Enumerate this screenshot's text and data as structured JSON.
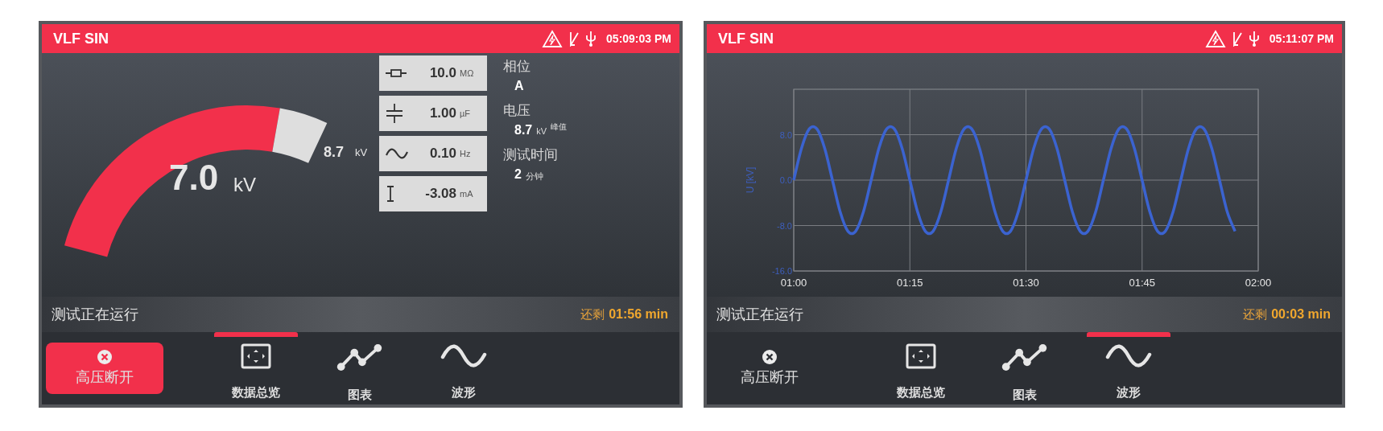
{
  "screens": [
    {
      "kind": "gauge",
      "header": {
        "title": "VLF SIN",
        "time": "05:09:03 PM"
      },
      "gauge": {
        "value": "7.0",
        "unit": "kV",
        "limit": "8.7",
        "limit_unit": "kV"
      },
      "readings": [
        {
          "kind": "resistance",
          "value": "10.0",
          "unit": "MΩ"
        },
        {
          "kind": "capacitance",
          "value": "1.00",
          "unit": "µF"
        },
        {
          "kind": "frequency",
          "value": "0.10",
          "unit": "Hz"
        },
        {
          "kind": "current",
          "value": "-3.08",
          "unit": "mA"
        }
      ],
      "info": [
        {
          "label": "相位",
          "value": "A"
        },
        {
          "label": "电压",
          "value": "8.7",
          "unit": "kV",
          "note": "峰值"
        },
        {
          "label": "测试时间",
          "value": "2",
          "unit": "分钟"
        }
      ],
      "status": {
        "text": "测试正在运行",
        "remaining_label": "还剩",
        "remaining": "01:56 min"
      },
      "stop_button": {
        "label": "高压断开",
        "active": true
      },
      "tabs": [
        {
          "kind": "overview",
          "label": "数据总览",
          "selected": true
        },
        {
          "kind": "chart",
          "label": "图表",
          "selected": false
        },
        {
          "kind": "wave",
          "label": "波形",
          "selected": false
        }
      ]
    },
    {
      "kind": "chart",
      "header": {
        "title": "VLF SIN",
        "time": "05:11:07 PM"
      },
      "chart_data": {
        "type": "line",
        "ylabel": "U [kV]",
        "x": [
          60,
          61,
          62,
          63,
          64,
          65,
          66,
          67,
          68,
          69,
          70,
          71,
          72,
          73,
          74,
          75,
          76,
          77,
          78,
          79,
          80,
          81,
          82,
          83,
          84,
          85,
          86,
          87,
          88,
          89,
          90,
          91,
          92,
          93,
          94,
          95,
          96,
          97,
          98,
          99,
          100,
          101,
          102,
          103,
          104,
          105,
          106,
          107,
          108,
          109,
          110,
          111,
          112,
          113,
          114,
          115,
          116,
          117
        ],
        "series": [
          {
            "color": "#3b63d0",
            "values": [
              0,
              5.6,
              9.0,
              9.0,
              5.6,
              0,
              -5.6,
              -9.0,
              -9.0,
              -5.6,
              0,
              5.6,
              9.0,
              9.0,
              5.6,
              0,
              -5.6,
              -9.0,
              -9.0,
              -5.6,
              0,
              5.6,
              9.0,
              9.0,
              5.6,
              0,
              -5.6,
              -9.0,
              -9.0,
              -5.6,
              0,
              5.6,
              9.0,
              9.0,
              5.6,
              0,
              -5.6,
              -9.0,
              -9.0,
              -5.6,
              0,
              5.6,
              9.0,
              9.0,
              5.6,
              0,
              -5.6,
              -9.0,
              -9.0,
              -5.6,
              0,
              5.6,
              9.0,
              9.0,
              5.6,
              0,
              -5.6,
              -9.0
            ]
          }
        ],
        "xlim": [
          60,
          120
        ],
        "ylim": [
          -16,
          16
        ],
        "grid": true,
        "xticks": [
          {
            "value": 60,
            "label": "01:00"
          },
          {
            "value": 75,
            "label": "01:15"
          },
          {
            "value": 90,
            "label": "01:30"
          },
          {
            "value": 105,
            "label": "01:45"
          },
          {
            "value": 120,
            "label": "02:00"
          }
        ],
        "yticks": [
          {
            "value": 8,
            "label": "8.0"
          },
          {
            "value": 0,
            "label": "0.0"
          },
          {
            "value": -8,
            "label": "-8.0"
          },
          {
            "value": -16,
            "label": "-16.0"
          }
        ]
      },
      "status": {
        "text": "测试正在运行",
        "remaining_label": "还剩",
        "remaining": "00:03 min"
      },
      "stop_button": {
        "label": "高压断开",
        "active": false
      },
      "tabs": [
        {
          "kind": "overview",
          "label": "数据总览",
          "selected": false
        },
        {
          "kind": "chart",
          "label": "图表",
          "selected": false
        },
        {
          "kind": "wave",
          "label": "波形",
          "selected": true
        }
      ]
    }
  ]
}
